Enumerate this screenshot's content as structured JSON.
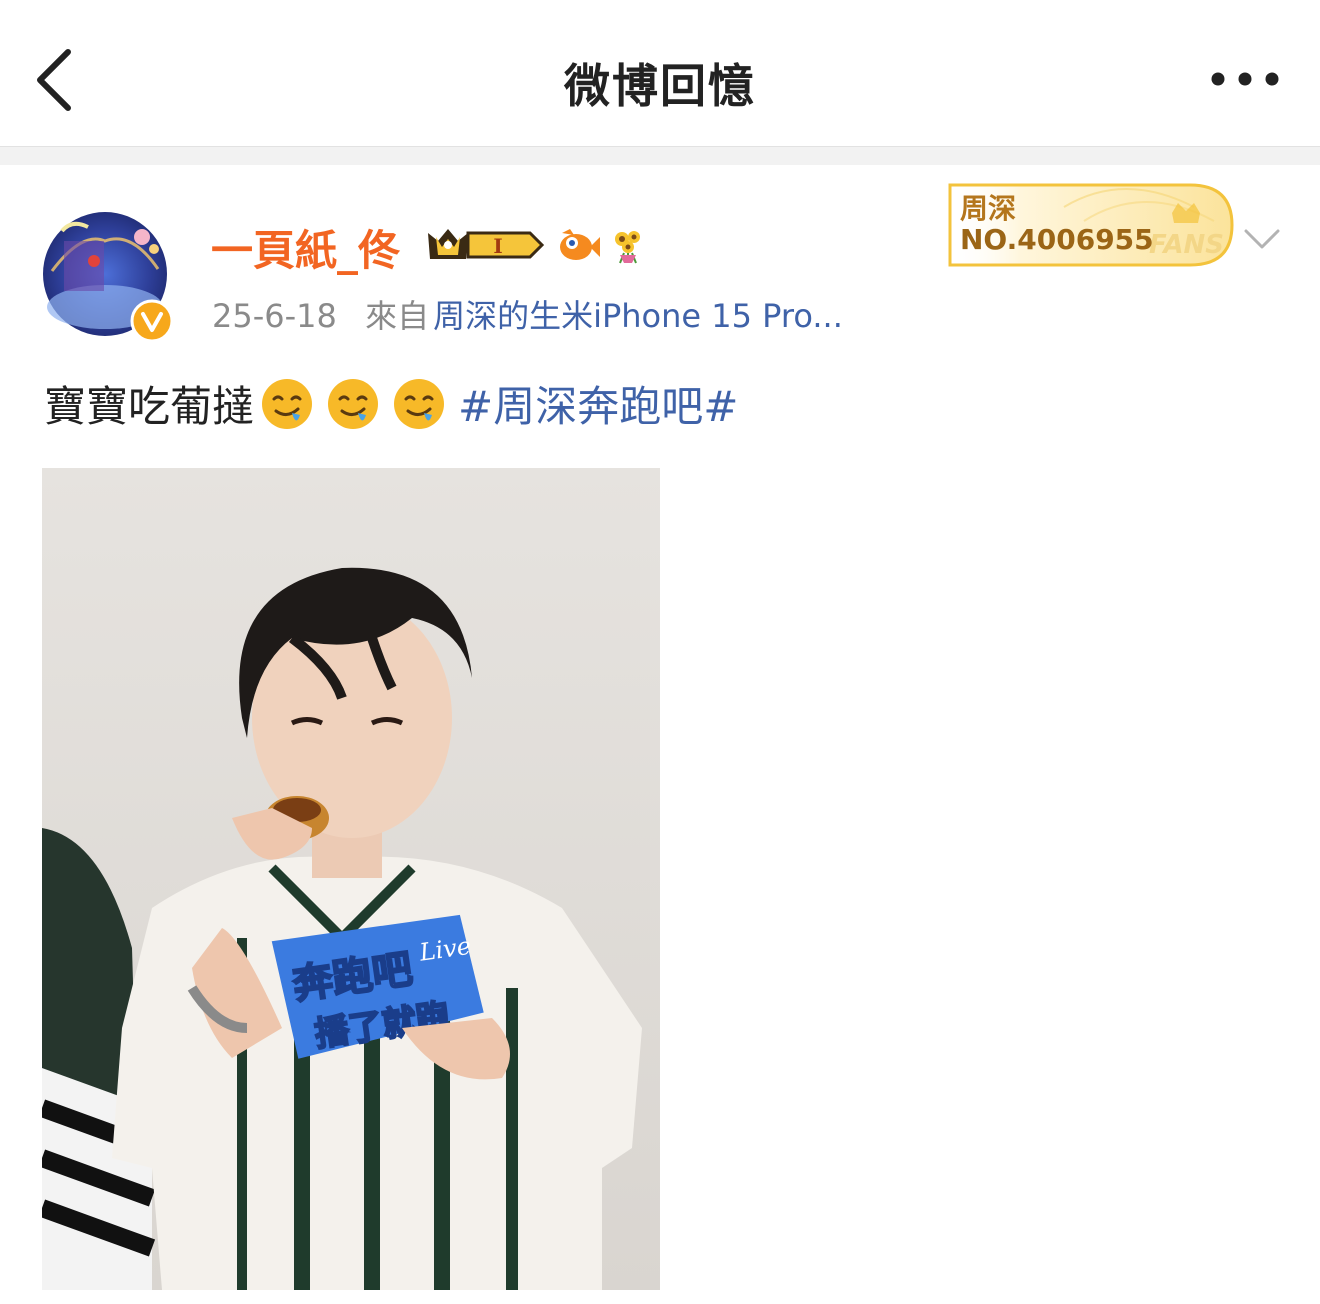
{
  "nav": {
    "title": "微博回憶",
    "back_icon": "chevron-left-icon",
    "more_icon": "more-dots-icon"
  },
  "post": {
    "username": "一頁紙_佟",
    "badges": [
      "crown-level-badge",
      "fish-icon",
      "sunflower-icon"
    ],
    "level_badge_text": "I",
    "date": "25-6-18",
    "source_prefix": "來自",
    "source": "周深的生米iPhone 15 Pro...",
    "fan_card": {
      "name": "周深",
      "number": "NO.4006955",
      "tag": "FANS"
    },
    "text": "寶寶吃葡撻",
    "emojis": [
      "drooling-face-emoji",
      "drooling-face-emoji",
      "drooling-face-emoji"
    ],
    "hashtag": "#周深奔跑吧#",
    "photo_sign": {
      "line1": "奔跑吧",
      "line2": "播了就跑",
      "script": "Live"
    }
  },
  "colors": {
    "username": "#f26522",
    "link": "#3f62a8",
    "meta": "#8a8a8a",
    "fan_gold": "#f3c33c"
  }
}
